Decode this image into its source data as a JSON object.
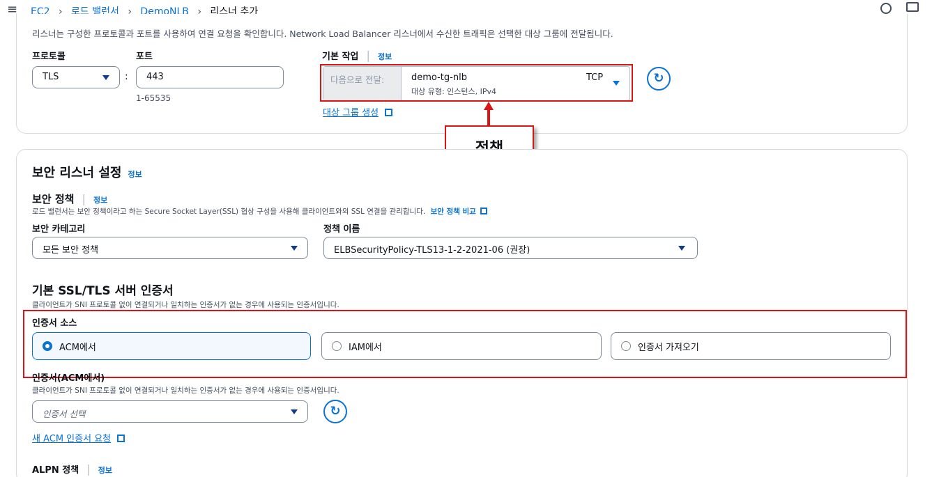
{
  "topbar": {
    "breadcrumb": [
      "EC2",
      "로드 밸런서",
      "DemoNLB",
      "리스너 추가"
    ]
  },
  "listener": {
    "description": "리스너는 구성한 프로토콜과 포트를 사용하여 연결 요청을 확인합니다. Network Load Balancer 리스너에서 수신한 트래픽은 선택한 대상 그룹에 전달됩니다.",
    "protocol_label": "프로토콜",
    "protocol_value": "TLS",
    "port_label": "포트",
    "port_value": "443",
    "port_hint": "1-65535",
    "default_action_label": "기본 작업",
    "info": "정보",
    "forward_to_label": "다음으로 전달:",
    "target_group_name": "demo-tg-nlb",
    "target_group_protocol": "TCP",
    "target_group_type": "대상 유형: 인스턴스, IPv4",
    "create_target_group": "대상 그룹 생성"
  },
  "annotation": {
    "callout": "정책"
  },
  "secure": {
    "section_title": "보안 리스너 설정",
    "info": "정보",
    "policy_title": "보안 정책",
    "policy_desc": "로드 밸런서는 보안 정책이라고 하는 Secure Socket Layer(SSL) 협상 구성을 사용해 클라이언트와의 SSL 연결을 관리합니다.",
    "policy_compare": "보안 정책 비교",
    "category_label": "보안 카테고리",
    "category_value": "모든 보안 정책",
    "policy_name_label": "정책 이름",
    "policy_name_value": "ELBSecurityPolicy-TLS13-1-2-2021-06 (권장)",
    "cert_title": "기본 SSL/TLS 서버 인증서",
    "cert_desc": "클라이언트가 SNI 프로토콜 없이 연결되거나 일치하는 인증서가 없는 경우에 사용되는 인증서입니다.",
    "cert_source_label": "인증서 소스",
    "cert_source_options": [
      "ACM에서",
      "IAM에서",
      "인증서 가져오기"
    ],
    "cert_acm_label": "인증서(ACM에서)",
    "cert_acm_desc": "클라이언트가 SNI 프로토콜 없이 연결되거나 일치하는 인증서가 없는 경우에 사용되는 인증서입니다.",
    "cert_select_placeholder": "인증서 선택",
    "new_acm_request": "새 ACM 인증서 요청",
    "alpn_title": "ALPN 정책"
  },
  "colors": {
    "accent": "#0972d3",
    "highlight_red": "#d91515"
  }
}
